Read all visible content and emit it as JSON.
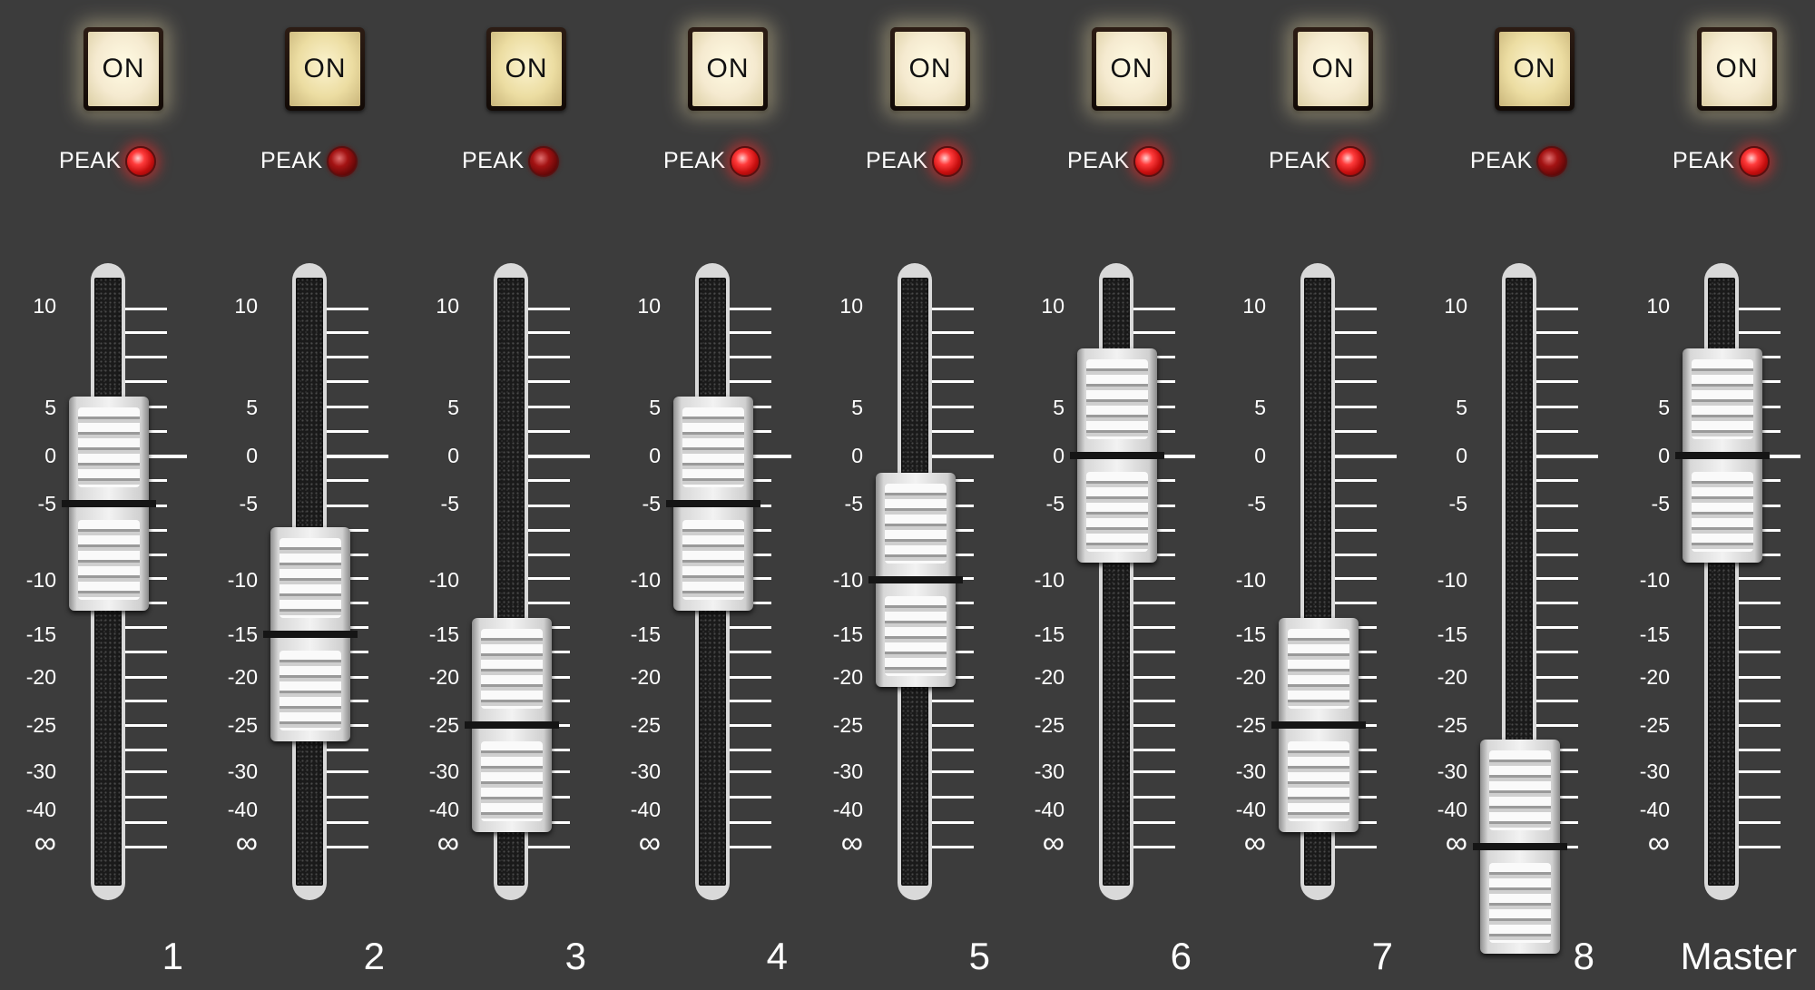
{
  "on_label": "ON",
  "peak_label": "PEAK",
  "scale": [
    "10",
    "5",
    "0",
    "-5",
    "-10",
    "-15",
    "-20",
    "-25",
    "-30",
    "-40",
    "∞"
  ],
  "channels": [
    {
      "name": "1",
      "on_lit": true,
      "peak_lit": true,
      "fader_db": -5
    },
    {
      "name": "2",
      "on_lit": false,
      "peak_lit": false,
      "fader_db": -15
    },
    {
      "name": "3",
      "on_lit": false,
      "peak_lit": false,
      "fader_db": -25
    },
    {
      "name": "4",
      "on_lit": true,
      "peak_lit": true,
      "fader_db": -5
    },
    {
      "name": "5",
      "on_lit": true,
      "peak_lit": true,
      "fader_db": -10
    },
    {
      "name": "6",
      "on_lit": true,
      "peak_lit": true,
      "fader_db": 0
    },
    {
      "name": "7",
      "on_lit": true,
      "peak_lit": true,
      "fader_db": -25
    },
    {
      "name": "8",
      "on_lit": false,
      "peak_lit": false,
      "fader_db": -50
    },
    {
      "name": "Master",
      "on_lit": true,
      "peak_lit": true,
      "fader_db": 0
    }
  ]
}
